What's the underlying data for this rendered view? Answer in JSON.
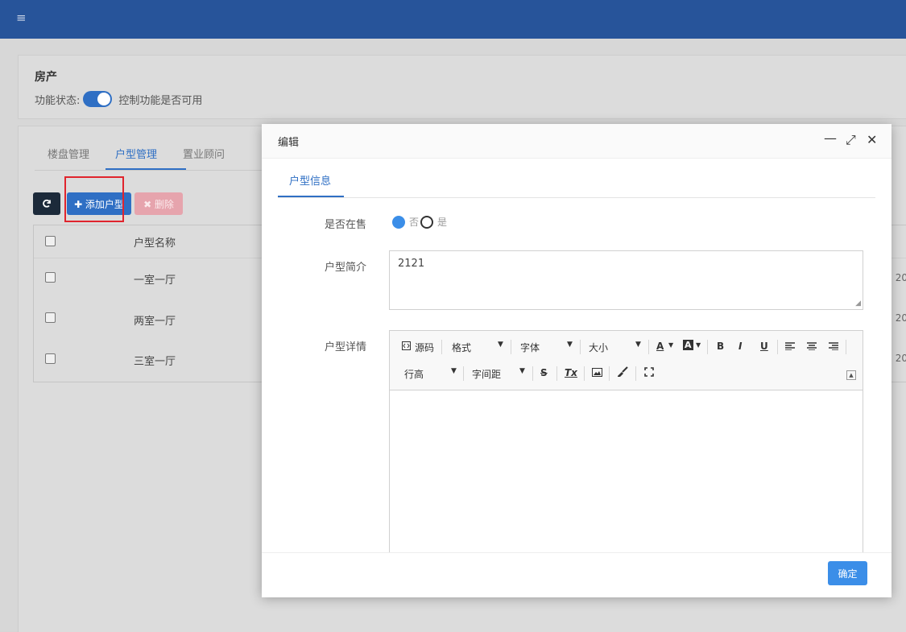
{
  "topbar": {
    "menu_glyph": "≡"
  },
  "property_card": {
    "title": "房产",
    "status_label": "功能状态:",
    "status_on": true,
    "status_desc": "控制功能是否可用"
  },
  "tabs": [
    {
      "label": "楼盘管理",
      "active": false
    },
    {
      "label": "户型管理",
      "active": true
    },
    {
      "label": "置业顾问",
      "active": false
    }
  ],
  "toolbar": {
    "refresh_icon": "refresh-icon",
    "add_label": "✚ 添加户型",
    "delete_label": "✖ 删除"
  },
  "grid": {
    "header": "户型名称",
    "rows": [
      {
        "name": "一室一厅",
        "date_fragment": "20"
      },
      {
        "name": "两室一厅",
        "date_fragment": "20"
      },
      {
        "name": "三室一厅",
        "date_fragment": "20"
      }
    ]
  },
  "modal": {
    "title": "编辑",
    "controls": {
      "minimize": "—",
      "maximize": "⤢",
      "close": "✕"
    },
    "tab": "户型信息",
    "on_sale": {
      "label": "是否在售",
      "options": [
        "否",
        "是"
      ],
      "selected": "否"
    },
    "intro": {
      "label": "户型简介",
      "value": "2121"
    },
    "detail": {
      "label": "户型详情",
      "toolbar_row1": {
        "source": "源码",
        "format": "格式",
        "font": "字体",
        "size": "大小",
        "font_color": "A",
        "bg_color": "A",
        "bold": "B",
        "italic": "I",
        "underline": "U"
      },
      "toolbar_row2": {
        "line_height": "行高",
        "letter_spacing": "字间距",
        "strike": "S",
        "remove_format": "Tx"
      }
    },
    "confirm_label": "确定"
  },
  "colors": {
    "primary": "#2f6fc4",
    "topbar": "#27549a",
    "accent": "#3b8ee8",
    "highlight": "#e0242d"
  }
}
